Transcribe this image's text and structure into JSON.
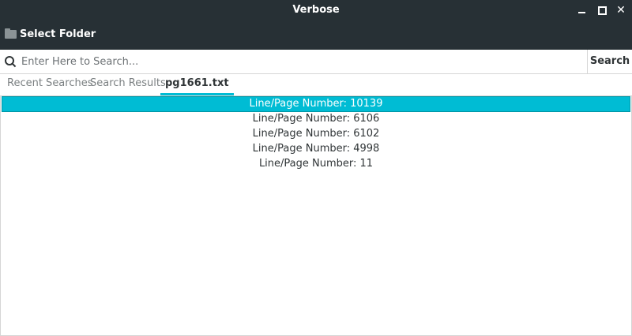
{
  "window": {
    "title": "Verbose"
  },
  "toolbar": {
    "select_folder_label": "Select Folder"
  },
  "search": {
    "placeholder": "Enter Here to Search...",
    "value": "",
    "button_label": "Search"
  },
  "tabs": [
    {
      "label": "Recent Searches",
      "active": false
    },
    {
      "label": "Search Results",
      "active": false
    },
    {
      "label": "pg1661.txt",
      "active": true
    }
  ],
  "results": [
    {
      "label": "Line/Page Number: 10139",
      "selected": true
    },
    {
      "label": "Line/Page Number: 6106",
      "selected": false
    },
    {
      "label": "Line/Page Number: 6102",
      "selected": false
    },
    {
      "label": "Line/Page Number: 4998",
      "selected": false
    },
    {
      "label": "Line/Page Number: 11",
      "selected": false
    }
  ],
  "colors": {
    "titlebar_bg": "#273035",
    "accent": "#00bcd4"
  },
  "icons": {
    "folder": "folder-icon",
    "search": "search-icon",
    "minimize": "minimize-icon",
    "maximize": "maximize-icon",
    "close": "close-icon"
  }
}
